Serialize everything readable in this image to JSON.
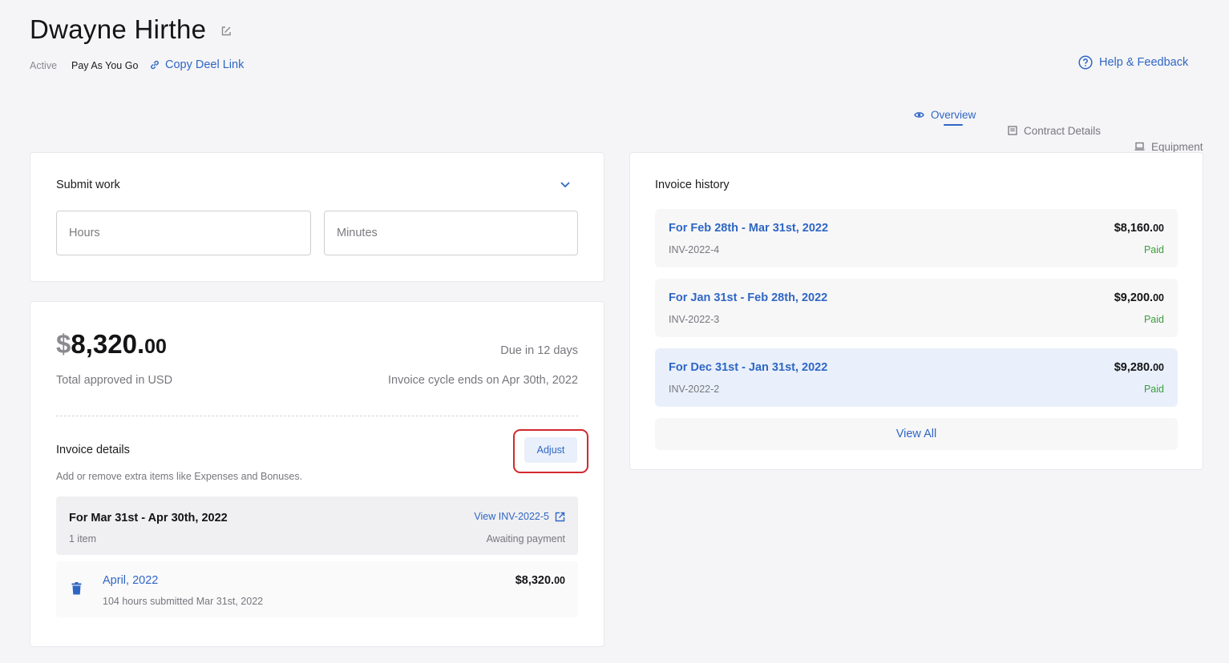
{
  "header": {
    "title": "Dwayne Hirthe",
    "status": "Active",
    "plan": "Pay As You Go",
    "copy_link_label": "Copy Deel Link",
    "help_label": "Help & Feedback"
  },
  "tabs": [
    {
      "label": "Overview",
      "icon": "eye-icon",
      "active": true
    },
    {
      "label": "Contract Details",
      "icon": "document-icon",
      "active": false
    },
    {
      "label": "Equipment",
      "icon": "laptop-icon",
      "active": false
    }
  ],
  "submit_work": {
    "title": "Submit work",
    "hours_placeholder": "Hours",
    "minutes_placeholder": "Minutes"
  },
  "invoice": {
    "currency_symbol": "$",
    "amount_main": "8,320.",
    "amount_cents": "00",
    "total_label": "Total approved in USD",
    "due": "Due in 12 days",
    "cycle_end": "Invoice cycle ends on Apr 30th, 2022",
    "details_title": "Invoice details",
    "adjust_label": "Adjust",
    "details_desc": "Add or remove extra items like Expenses and Bonuses.",
    "period": {
      "label": "For Mar 31st - Apr 30th, 2022",
      "view_link": "View INV-2022-5",
      "item_count": "1 item",
      "status": "Awaiting payment"
    },
    "line_item": {
      "title": "April, 2022",
      "desc": "104 hours submitted Mar 31st, 2022",
      "amount_main": "$8,320.",
      "amount_cents": "00"
    }
  },
  "history": {
    "title": "Invoice history",
    "items": [
      {
        "period": "For Feb 28th - Mar 31st, 2022",
        "id": "INV-2022-4",
        "amount_main": "$8,160.",
        "amount_cents": "00",
        "status": "Paid"
      },
      {
        "period": "For Jan 31st - Feb 28th, 2022",
        "id": "INV-2022-3",
        "amount_main": "$9,200.",
        "amount_cents": "00",
        "status": "Paid"
      },
      {
        "period": "For Dec 31st - Jan 31st, 2022",
        "id": "INV-2022-2",
        "amount_main": "$9,280.",
        "amount_cents": "00",
        "status": "Paid"
      }
    ],
    "view_all_label": "View All"
  },
  "colors": {
    "accent": "#2f66c4",
    "paid": "#3b9d3b",
    "highlight": "#d2282e"
  }
}
